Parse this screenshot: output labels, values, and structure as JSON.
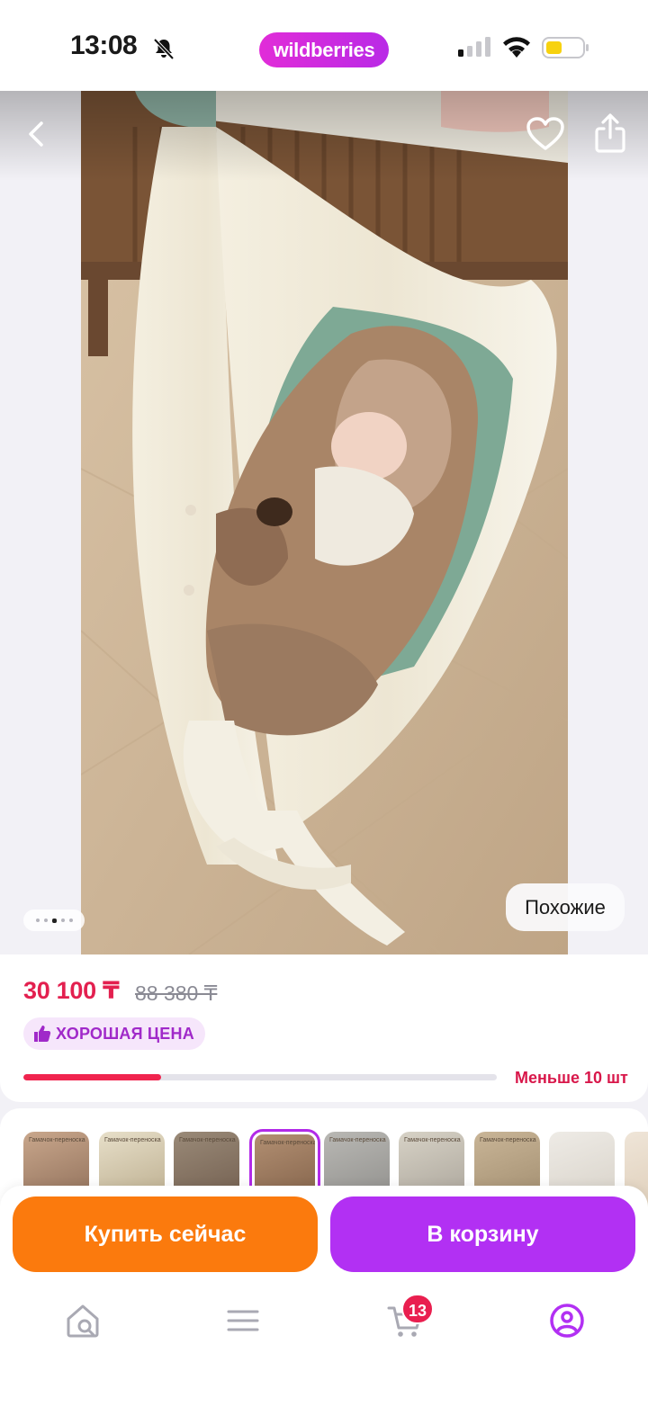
{
  "status_bar": {
    "time": "13:08",
    "brand": "wildberries",
    "silent_icon": "bell-slash-icon",
    "signal_icon": "cellular-signal-icon",
    "wifi_icon": "wifi-icon",
    "battery_icon": "battery-low-icon"
  },
  "gallery": {
    "back_icon": "chevron-left-icon",
    "favorite_icon": "heart-icon",
    "share_icon": "share-icon",
    "similar_label": "Похожие",
    "page_indicator": {
      "count": 5,
      "active_index": 3
    }
  },
  "product": {
    "price": "30 100 ₸",
    "old_price": "88 380 ₸",
    "good_price_badge": "ХОРОШАЯ ЦЕНА",
    "stock_text": "Меньше 10 шт",
    "stock_level": 0.29
  },
  "thumbnails": {
    "selected_index": 3,
    "items": [
      {
        "caption": "Гамачок-переноска"
      },
      {
        "caption": "Гамачок-переноска"
      },
      {
        "caption": "Гамачок-переноска"
      },
      {
        "caption": "Гамачок-переноска"
      },
      {
        "caption": "Гамачок-переноска"
      },
      {
        "caption": "Гамачок-переноска"
      },
      {
        "caption": "Гамачок-переноска"
      },
      {
        "caption": ""
      },
      {
        "caption": ""
      }
    ]
  },
  "actions": {
    "buy_now": "Купить сейчас",
    "add_to_cart": "В корзину"
  },
  "tabbar": {
    "home_icon": "home-search-icon",
    "catalog_icon": "menu-icon",
    "cart_icon": "cart-icon",
    "cart_badge": "13",
    "profile_icon": "profile-icon",
    "accent": "#b230f3"
  }
}
